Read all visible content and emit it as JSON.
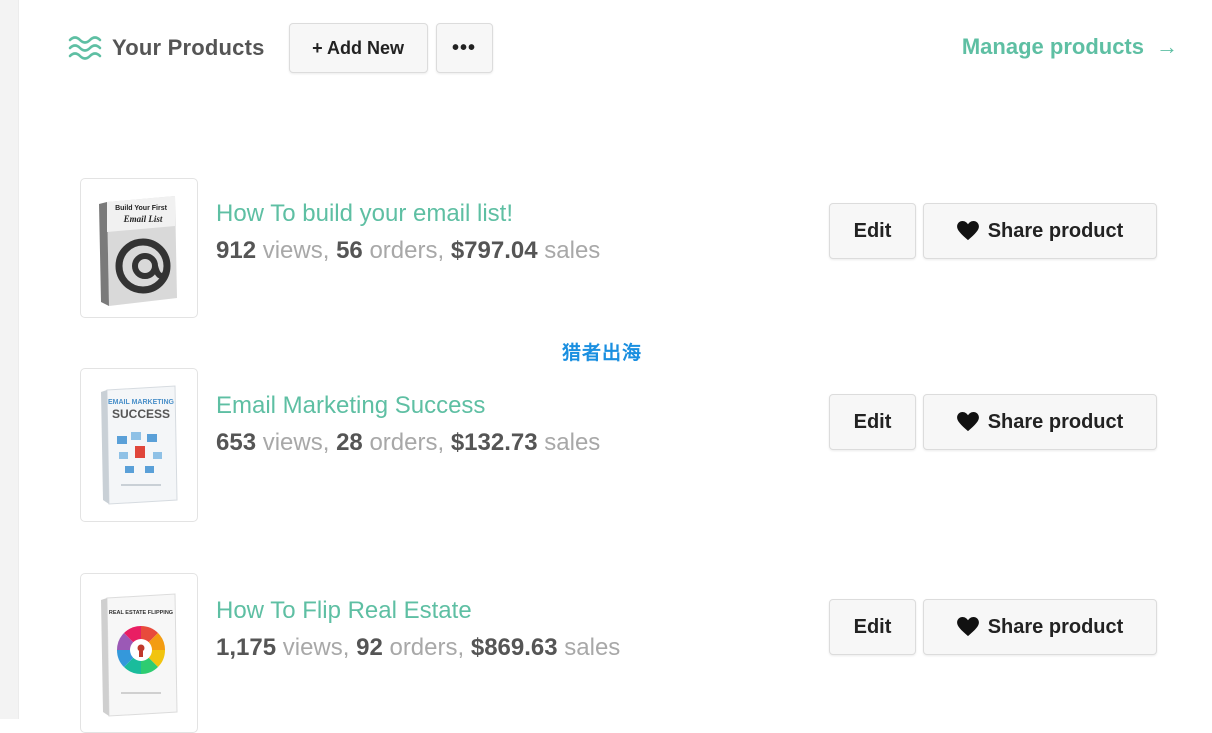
{
  "header": {
    "title": "Your Products",
    "add_new_label": "+ Add New",
    "more_label": "•••",
    "manage_label": "Manage products",
    "manage_arrow": "→"
  },
  "products": [
    {
      "title": "How To build your email list!",
      "views": "912",
      "views_label": "views,",
      "orders": "56",
      "orders_label": "orders,",
      "sales": "$797.04",
      "sales_label": "sales",
      "cover_text_line1": "Build Your First",
      "cover_text_line2": "Email List",
      "edit_label": "Edit",
      "share_label": "Share product"
    },
    {
      "title": "Email Marketing Success",
      "views": "653",
      "views_label": "views,",
      "orders": "28",
      "orders_label": "orders,",
      "sales": "$132.73",
      "sales_label": "sales",
      "cover_text_line1": "EMAIL MARKETING",
      "cover_text_line2": "SUCCESS",
      "edit_label": "Edit",
      "share_label": "Share product"
    },
    {
      "title": "How To Flip Real Estate",
      "views": "1,175",
      "views_label": "views,",
      "orders": "92",
      "orders_label": "orders,",
      "sales": "$869.63",
      "sales_label": "sales",
      "cover_text_line1": "REAL ESTATE FLIPPING",
      "edit_label": "Edit",
      "share_label": "Share product"
    }
  ],
  "watermark": "猎者出海",
  "colors": {
    "accent": "#5ebfa3",
    "stat_number": "#555555",
    "stat_label": "#a8a8a8",
    "watermark": "#1a8fe0"
  },
  "icons": {
    "products": "wavy-lines-icon",
    "share": "heart-icon",
    "manage": "arrow-right-icon"
  }
}
